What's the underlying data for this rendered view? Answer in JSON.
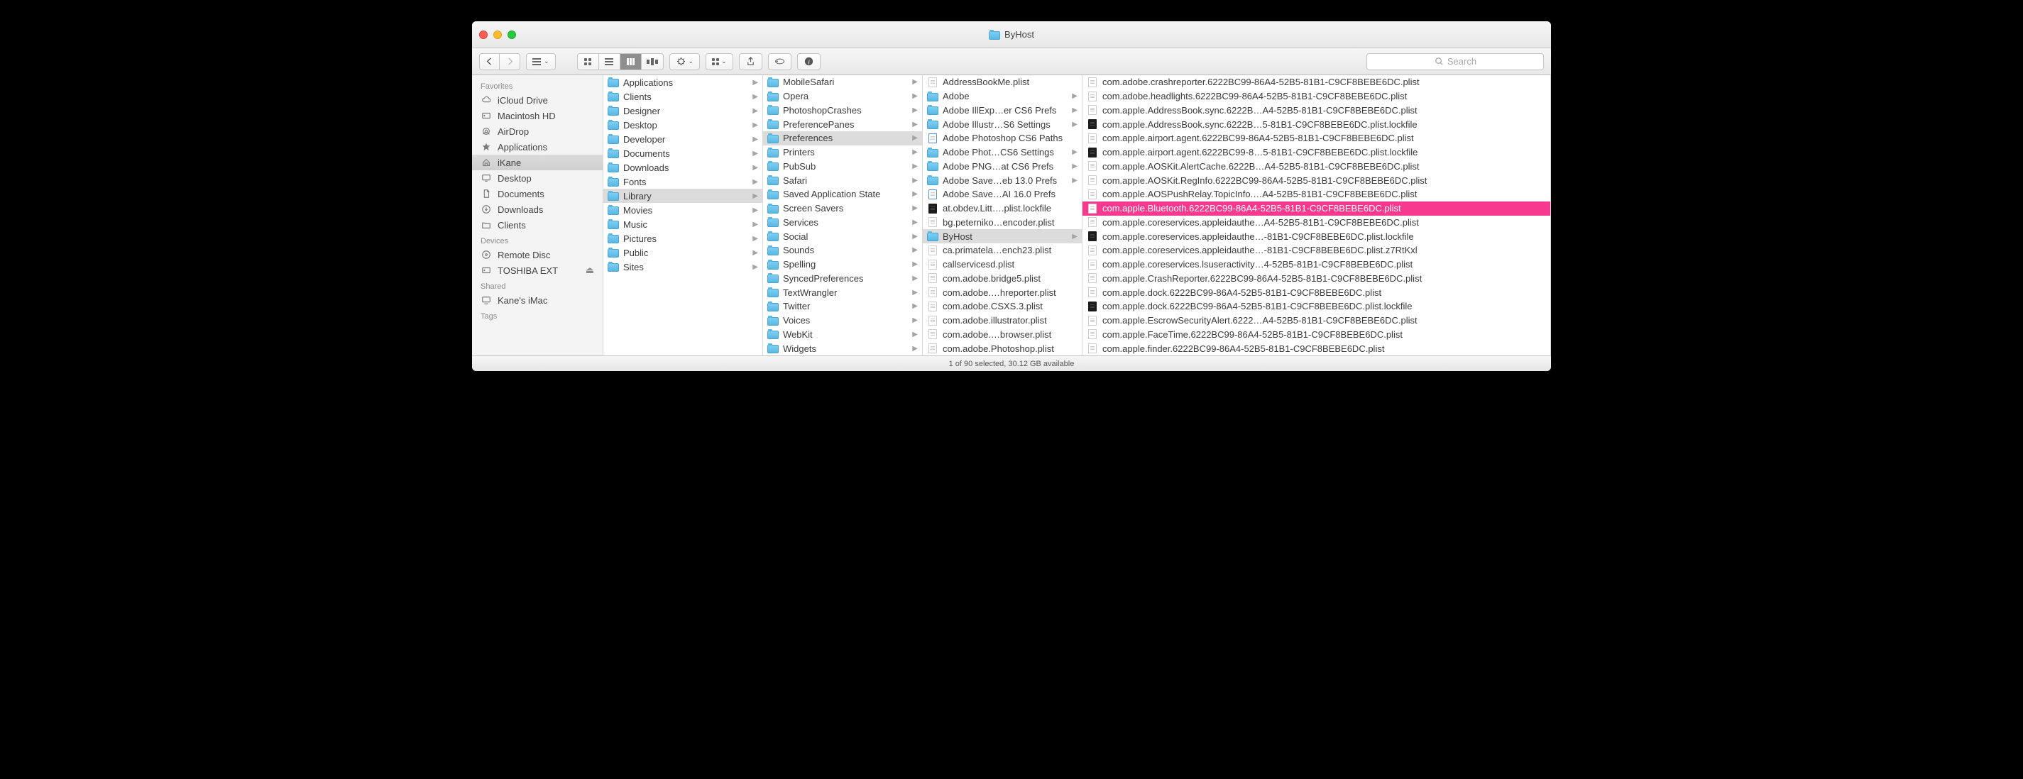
{
  "window": {
    "title": "ByHost"
  },
  "toolbar": {
    "search_placeholder": "Search"
  },
  "sidebar": {
    "sections": [
      {
        "header": "Favorites",
        "items": [
          {
            "icon": "cloud",
            "label": "iCloud Drive"
          },
          {
            "icon": "hdd",
            "label": "Macintosh HD"
          },
          {
            "icon": "airdrop",
            "label": "AirDrop"
          },
          {
            "icon": "apps",
            "label": "Applications"
          },
          {
            "icon": "home",
            "label": "iKane",
            "selected": true
          },
          {
            "icon": "desktop",
            "label": "Desktop"
          },
          {
            "icon": "docs",
            "label": "Documents"
          },
          {
            "icon": "downloads",
            "label": "Downloads"
          },
          {
            "icon": "folder",
            "label": "Clients"
          }
        ]
      },
      {
        "header": "Devices",
        "items": [
          {
            "icon": "disc",
            "label": "Remote Disc"
          },
          {
            "icon": "hdd",
            "label": "TOSHIBA EXT",
            "eject": true
          }
        ]
      },
      {
        "header": "Shared",
        "items": [
          {
            "icon": "screen",
            "label": "Kane's iMac"
          }
        ]
      },
      {
        "header": "Tags",
        "items": []
      }
    ]
  },
  "columns": [
    {
      "items": [
        {
          "t": "folder",
          "label": "Applications",
          "arrow": true
        },
        {
          "t": "folder",
          "label": "Clients",
          "arrow": true
        },
        {
          "t": "folder",
          "label": "Designer",
          "arrow": true
        },
        {
          "t": "folder",
          "label": "Desktop",
          "arrow": true
        },
        {
          "t": "folder",
          "label": "Developer",
          "arrow": true
        },
        {
          "t": "folder",
          "label": "Documents",
          "arrow": true
        },
        {
          "t": "folder",
          "label": "Downloads",
          "arrow": true
        },
        {
          "t": "folder",
          "label": "Fonts",
          "arrow": true
        },
        {
          "t": "folder",
          "label": "Library",
          "arrow": true,
          "sel": "gray"
        },
        {
          "t": "folder",
          "label": "Movies",
          "arrow": true
        },
        {
          "t": "folder",
          "label": "Music",
          "arrow": true
        },
        {
          "t": "folder",
          "label": "Pictures",
          "arrow": true
        },
        {
          "t": "folder",
          "label": "Public",
          "arrow": true
        },
        {
          "t": "folder",
          "label": "Sites",
          "arrow": true
        }
      ]
    },
    {
      "items": [
        {
          "t": "folder",
          "label": "MobileSafari",
          "arrow": true
        },
        {
          "t": "folder",
          "label": "Opera",
          "arrow": true
        },
        {
          "t": "folder",
          "label": "PhotoshopCrashes",
          "arrow": true
        },
        {
          "t": "folder",
          "label": "PreferencePanes",
          "arrow": true
        },
        {
          "t": "folder",
          "label": "Preferences",
          "arrow": true,
          "sel": "gray"
        },
        {
          "t": "folder",
          "label": "Printers",
          "arrow": true
        },
        {
          "t": "folder",
          "label": "PubSub",
          "arrow": true
        },
        {
          "t": "folder",
          "label": "Safari",
          "arrow": true
        },
        {
          "t": "folder",
          "label": "Saved Application State",
          "arrow": true
        },
        {
          "t": "folder",
          "label": "Screen Savers",
          "arrow": true
        },
        {
          "t": "folder",
          "label": "Services",
          "arrow": true
        },
        {
          "t": "folder",
          "label": "Social",
          "arrow": true
        },
        {
          "t": "folder",
          "label": "Sounds",
          "arrow": true
        },
        {
          "t": "folder",
          "label": "Spelling",
          "arrow": true
        },
        {
          "t": "folder",
          "label": "SyncedPreferences",
          "arrow": true
        },
        {
          "t": "folder",
          "label": "TextWrangler",
          "arrow": true
        },
        {
          "t": "folder",
          "label": "Twitter",
          "arrow": true
        },
        {
          "t": "folder",
          "label": "Voices",
          "arrow": true
        },
        {
          "t": "folder",
          "label": "WebKit",
          "arrow": true
        },
        {
          "t": "folder",
          "label": "Widgets",
          "arrow": true
        }
      ]
    },
    {
      "items": [
        {
          "t": "doc",
          "label": "AddressBookMe.plist"
        },
        {
          "t": "folder",
          "label": "Adobe",
          "arrow": true
        },
        {
          "t": "folder",
          "label": "Adobe IllExp…er CS6 Prefs",
          "arrow": true
        },
        {
          "t": "folder",
          "label": "Adobe Illustr…S6 Settings",
          "arrow": true
        },
        {
          "t": "docblue",
          "label": "Adobe Photoshop CS6 Paths"
        },
        {
          "t": "folder",
          "label": "Adobe Phot…CS6 Settings",
          "arrow": true
        },
        {
          "t": "folder",
          "label": "Adobe PNG…at CS6 Prefs",
          "arrow": true
        },
        {
          "t": "folder",
          "label": "Adobe Save…eb 13.0 Prefs",
          "arrow": true
        },
        {
          "t": "docblue",
          "label": "Adobe Save…AI 16.0 Prefs"
        },
        {
          "t": "black",
          "label": "at.obdev.Litt….plist.lockfile"
        },
        {
          "t": "doc",
          "label": "bg.peterniko…encoder.plist"
        },
        {
          "t": "folder",
          "label": "ByHost",
          "arrow": true,
          "sel": "gray"
        },
        {
          "t": "doc",
          "label": "ca.primatela…ench23.plist"
        },
        {
          "t": "doc",
          "label": "callservicesd.plist"
        },
        {
          "t": "doc",
          "label": "com.adobe.bridge5.plist"
        },
        {
          "t": "doc",
          "label": "com.adobe.…hreporter.plist"
        },
        {
          "t": "doc",
          "label": "com.adobe.CSXS.3.plist"
        },
        {
          "t": "doc",
          "label": "com.adobe.illustrator.plist"
        },
        {
          "t": "doc",
          "label": "com.adobe.…browser.plist"
        },
        {
          "t": "doc",
          "label": "com.adobe.Photoshop.plist"
        }
      ]
    },
    {
      "items": [
        {
          "t": "doc",
          "label": "com.adobe.crashreporter.6222BC99-86A4-52B5-81B1-C9CF8BEBE6DC.plist"
        },
        {
          "t": "doc",
          "label": "com.adobe.headlights.6222BC99-86A4-52B5-81B1-C9CF8BEBE6DC.plist"
        },
        {
          "t": "doc",
          "label": "com.apple.AddressBook.sync.6222B…A4-52B5-81B1-C9CF8BEBE6DC.plist"
        },
        {
          "t": "black",
          "label": "com.apple.AddressBook.sync.6222B…5-81B1-C9CF8BEBE6DC.plist.lockfile"
        },
        {
          "t": "doc",
          "label": "com.apple.airport.agent.6222BC99-86A4-52B5-81B1-C9CF8BEBE6DC.plist"
        },
        {
          "t": "black",
          "label": "com.apple.airport.agent.6222BC99-8…5-81B1-C9CF8BEBE6DC.plist.lockfile"
        },
        {
          "t": "doc",
          "label": "com.apple.AOSKit.AlertCache.6222B…A4-52B5-81B1-C9CF8BEBE6DC.plist"
        },
        {
          "t": "doc",
          "label": "com.apple.AOSKit.RegInfo.6222BC99-86A4-52B5-81B1-C9CF8BEBE6DC.plist"
        },
        {
          "t": "doc",
          "label": "com.apple.AOSPushRelay.TopicInfo.…A4-52B5-81B1-C9CF8BEBE6DC.plist"
        },
        {
          "t": "doc",
          "label": "com.apple.Bluetooth.6222BC99-86A4-52B5-81B1-C9CF8BEBE6DC.plist",
          "sel": "pink"
        },
        {
          "t": "doc",
          "label": "com.apple.coreservices.appleidauthe…A4-52B5-81B1-C9CF8BEBE6DC.plist"
        },
        {
          "t": "black",
          "label": "com.apple.coreservices.appleidauthe…-81B1-C9CF8BEBE6DC.plist.lockfile"
        },
        {
          "t": "doc",
          "label": "com.apple.coreservices.appleidauthe…-81B1-C9CF8BEBE6DC.plist.z7RtKxl"
        },
        {
          "t": "doc",
          "label": "com.apple.coreservices.lsuseractivity…4-52B5-81B1-C9CF8BEBE6DC.plist"
        },
        {
          "t": "doc",
          "label": "com.apple.CrashReporter.6222BC99-86A4-52B5-81B1-C9CF8BEBE6DC.plist"
        },
        {
          "t": "doc",
          "label": "com.apple.dock.6222BC99-86A4-52B5-81B1-C9CF8BEBE6DC.plist"
        },
        {
          "t": "black",
          "label": "com.apple.dock.6222BC99-86A4-52B5-81B1-C9CF8BEBE6DC.plist.lockfile"
        },
        {
          "t": "doc",
          "label": "com.apple.EscrowSecurityAlert.6222…A4-52B5-81B1-C9CF8BEBE6DC.plist"
        },
        {
          "t": "doc",
          "label": "com.apple.FaceTime.6222BC99-86A4-52B5-81B1-C9CF8BEBE6DC.plist"
        },
        {
          "t": "doc",
          "label": "com.apple.finder.6222BC99-86A4-52B5-81B1-C9CF8BEBE6DC.plist"
        }
      ]
    }
  ],
  "status": "1 of 90 selected, 30.12 GB available"
}
